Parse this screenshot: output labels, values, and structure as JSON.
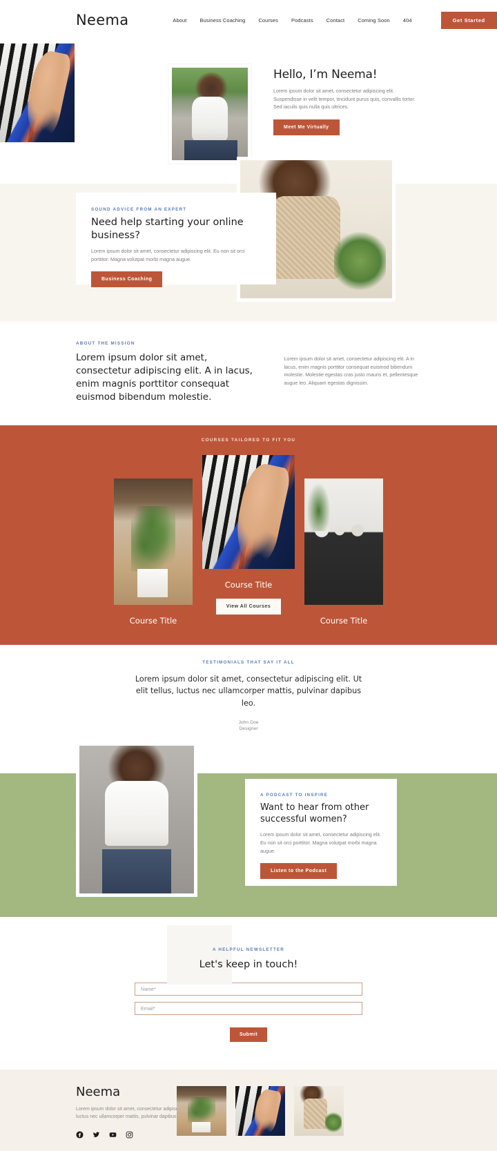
{
  "header": {
    "brand": "Neema",
    "nav": [
      {
        "label": "About"
      },
      {
        "label": "Business Coaching"
      },
      {
        "label": "Courses"
      },
      {
        "label": "Podcasts"
      },
      {
        "label": "Contact"
      },
      {
        "label": "Coming Soon"
      },
      {
        "label": "404"
      }
    ],
    "cta_label": "Get Started"
  },
  "hero": {
    "title": "Hello, I’m Neema!",
    "body": "Lorem ipsum dolor sit amet, consectetur adipiscing elit. Suspendisse in velit tempor, tincidunt purus quis, convallis tortor. Sed iaculis quis nulla quis ultrices.",
    "cta_label": "Meet Me Virtually",
    "image_left_name": "piano-hands-photo",
    "image_portrait_name": "neema-portrait-photo"
  },
  "advice": {
    "eyebrow": "SOUND ADVICE FROM AN EXPERT",
    "title": "Need help starting your online business?",
    "body": "Lorem ipsum dolor sit amet, consectetur adipiscing elit. Eu non sit orci porttitor. Magna volutpat morbi magna augue.",
    "cta_label": "Business Coaching",
    "image_name": "woman-with-phone-photo"
  },
  "mission": {
    "eyebrow": "ABOUT THE MISSION",
    "heading": "Lorem ipsum dolor sit amet, consectetur adipiscing elit. A in lacus, enim magnis porttitor consequat euismod bibendum molestie.",
    "body": "Lorem ipsum dolor sit amet, consectetur adipiscing elit. A in lacus, enim magnis porttitor consequat euismod bibendum molestie. Molestie egestas cras justo mauris et, pellentesque augue leo. Aliquam egestas dignissim."
  },
  "courses": {
    "eyebrow": "COURSES TAILORED TO FIT YOU",
    "items": [
      {
        "title": "Course Title",
        "image_name": "course-plant-photo"
      },
      {
        "title": "Course Title",
        "image_name": "course-piano-photo"
      },
      {
        "title": "Course Title",
        "image_name": "course-sofa-photo"
      }
    ],
    "cta_label": "View All Courses"
  },
  "testimonial": {
    "eyebrow": "TESTIMONIALS THAT SAY IT ALL",
    "quote": "Lorem ipsum dolor sit amet, consectetur adipiscing elit. Ut elit tellus, luctus nec ullamcorper mattis, pulvinar dapibus leo.",
    "name": "John Doe",
    "role": "Designer"
  },
  "podcast": {
    "eyebrow": "A PODCAST TO INSPIRE",
    "title": "Want to hear from other successful women?",
    "body": "Lorem ipsum dolor sit amet, consectetur adipiscing elit. Eu non sit orci porttitor. Magna volutpat morbi magna augue.",
    "cta_label": "Listen to the Podcast",
    "image_name": "woman-laughing-photo"
  },
  "newsletter": {
    "eyebrow": "A HELPFUL NEWSLETTER",
    "title": "Let's keep in touch!",
    "name_placeholder": "Name*",
    "name_value": "",
    "email_placeholder": "Email*",
    "email_value": "",
    "submit_label": "Submit"
  },
  "footer": {
    "brand": "Neema",
    "text": "Lorem ipsum dolor sit amet, consectetur adipiscing elit. Ut elit tellus, luctus nec ullamcorper mattis, pulvinar dapibus leo.",
    "socials": [
      {
        "name": "facebook-icon"
      },
      {
        "name": "twitter-icon"
      },
      {
        "name": "youtube-icon"
      },
      {
        "name": "instagram-icon"
      }
    ],
    "images": [
      {
        "name": "footer-plant-photo"
      },
      {
        "name": "footer-piano-photo"
      },
      {
        "name": "footer-woman-photo"
      }
    ]
  },
  "colors": {
    "accent": "#bd5638",
    "green": "#a3b781",
    "cream": "#f8f5ef",
    "footer_bg": "#f5f1ea",
    "eyebrow_blue": "#5a7cb4"
  }
}
